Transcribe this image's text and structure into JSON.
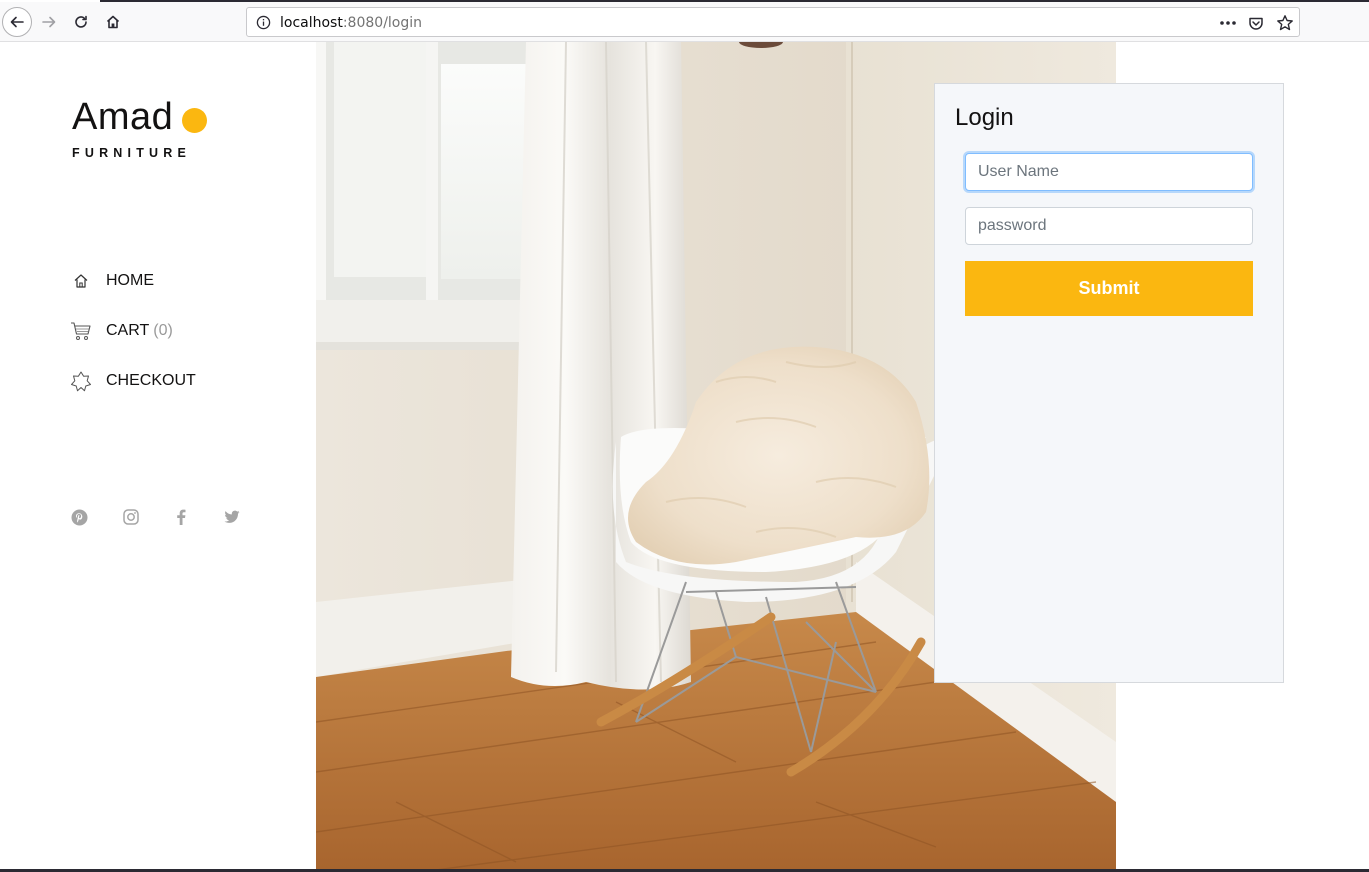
{
  "browser": {
    "url_host": "localhost",
    "url_rest": ":8080/login",
    "icons": [
      "back-icon",
      "forward-icon",
      "reload-icon",
      "home-icon",
      "info-icon",
      "more-icon",
      "pocket-icon",
      "bookmark-star-icon"
    ]
  },
  "brand": {
    "name": "Amad",
    "tagline": "FURNITURE",
    "accent": "#fbb710"
  },
  "nav": {
    "items": [
      {
        "label": "HOME",
        "icon": "home-icon"
      },
      {
        "label": "CART",
        "count": "(0)",
        "icon": "cart-icon"
      },
      {
        "label": "CHECKOUT",
        "icon": "star-icon"
      }
    ]
  },
  "social": [
    "pinterest-icon",
    "instagram-icon",
    "facebook-icon",
    "twitter-icon"
  ],
  "login": {
    "title": "Login",
    "username_placeholder": "User Name",
    "password_placeholder": "password",
    "submit_label": "Submit",
    "submit_color": "#fbb710"
  }
}
